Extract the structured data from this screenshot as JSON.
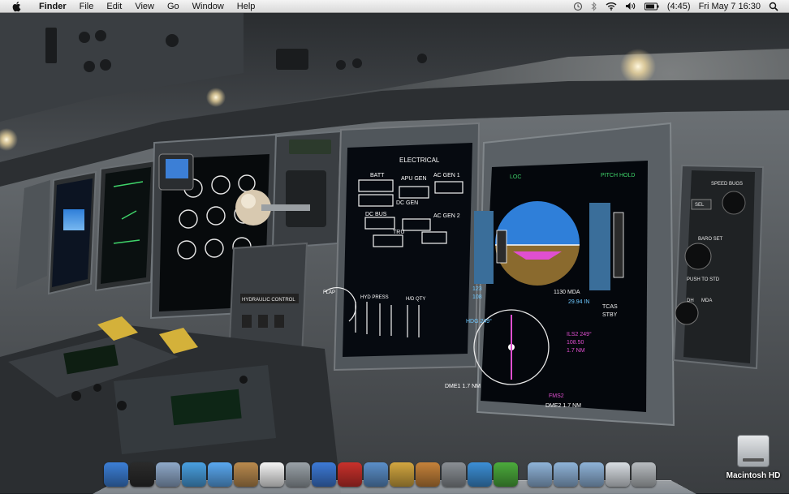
{
  "menubar": {
    "app_name": "Finder",
    "menus": [
      "File",
      "Edit",
      "View",
      "Go",
      "Window",
      "Help"
    ],
    "battery_time": "(4:45)",
    "clock": "Fri May 7  16:30"
  },
  "desktop": {
    "hd_label": "Macintosh HD"
  },
  "cockpit": {
    "eicas": {
      "batt": "BATT",
      "apu_gen": "APU GEN",
      "ac_gen_1": "AC GEN 1",
      "dc_gen": "DC GEN",
      "dc_bus": "DC BUS",
      "ac_gen_2": "AC GEN 2",
      "tru": "TRU",
      "hyd_press": "HYD PRESS",
      "hyd_qty": "H/D QTY",
      "flap": "FLAP"
    },
    "pfd": {
      "loc": "LOC",
      "pitch_hold": "PITCH HOLD",
      "speed_1": "123",
      "speed_2": "108",
      "mda": "1130 MDA",
      "baro": "29.94 IN",
      "tcas": "TCAS",
      "stby": "STBY",
      "hdg": "HDG 249°",
      "ils": "ILS2 249°",
      "freq": "108.50",
      "dist": "1.7 NM",
      "fms": "FMS2",
      "dme1": "DME1  1.7 NM",
      "dme2": "DME2  1.7 NM"
    },
    "side_panel": {
      "speed_bugs": "SPEED BUGS",
      "sel": "SEL",
      "baro_set": "BARO SET",
      "push_to_std": "PUSH TO STD",
      "dh": "DH",
      "mda": "MDA"
    },
    "hydraulic_label": "HYDRAULIC CONTROL"
  },
  "dock": {
    "items": [
      {
        "name": "finder",
        "color": "#3c7fd6"
      },
      {
        "name": "dashboard",
        "color": "#2b2b2b"
      },
      {
        "name": "mail",
        "color": "#8fa9c9"
      },
      {
        "name": "safari",
        "color": "#4aa0e0"
      },
      {
        "name": "ichat",
        "color": "#5aa8f0"
      },
      {
        "name": "address-book",
        "color": "#b98a4e"
      },
      {
        "name": "ical",
        "color": "#f4f4f4"
      },
      {
        "name": "preview",
        "color": "#9aa2a8"
      },
      {
        "name": "itunes",
        "color": "#3d7ad6"
      },
      {
        "name": "photo-booth",
        "color": "#c8312b"
      },
      {
        "name": "iphoto",
        "color": "#5b8fc9"
      },
      {
        "name": "imovie",
        "color": "#d2a640"
      },
      {
        "name": "garageband",
        "color": "#c5823a"
      },
      {
        "name": "system-preferences",
        "color": "#8a8f94"
      },
      {
        "name": "iweb",
        "color": "#3c8fd6"
      },
      {
        "name": "iweb-extra",
        "color": "#4cab3c"
      }
    ],
    "stacks": [
      {
        "name": "applications-folder",
        "color": "#8fb3d8"
      },
      {
        "name": "documents-folder",
        "color": "#8fb3d8"
      },
      {
        "name": "downloads-folder",
        "color": "#8fb3d8"
      },
      {
        "name": "web-page-document",
        "color": "#d8dde2"
      },
      {
        "name": "trash",
        "color": "#b8bcc0"
      }
    ]
  }
}
